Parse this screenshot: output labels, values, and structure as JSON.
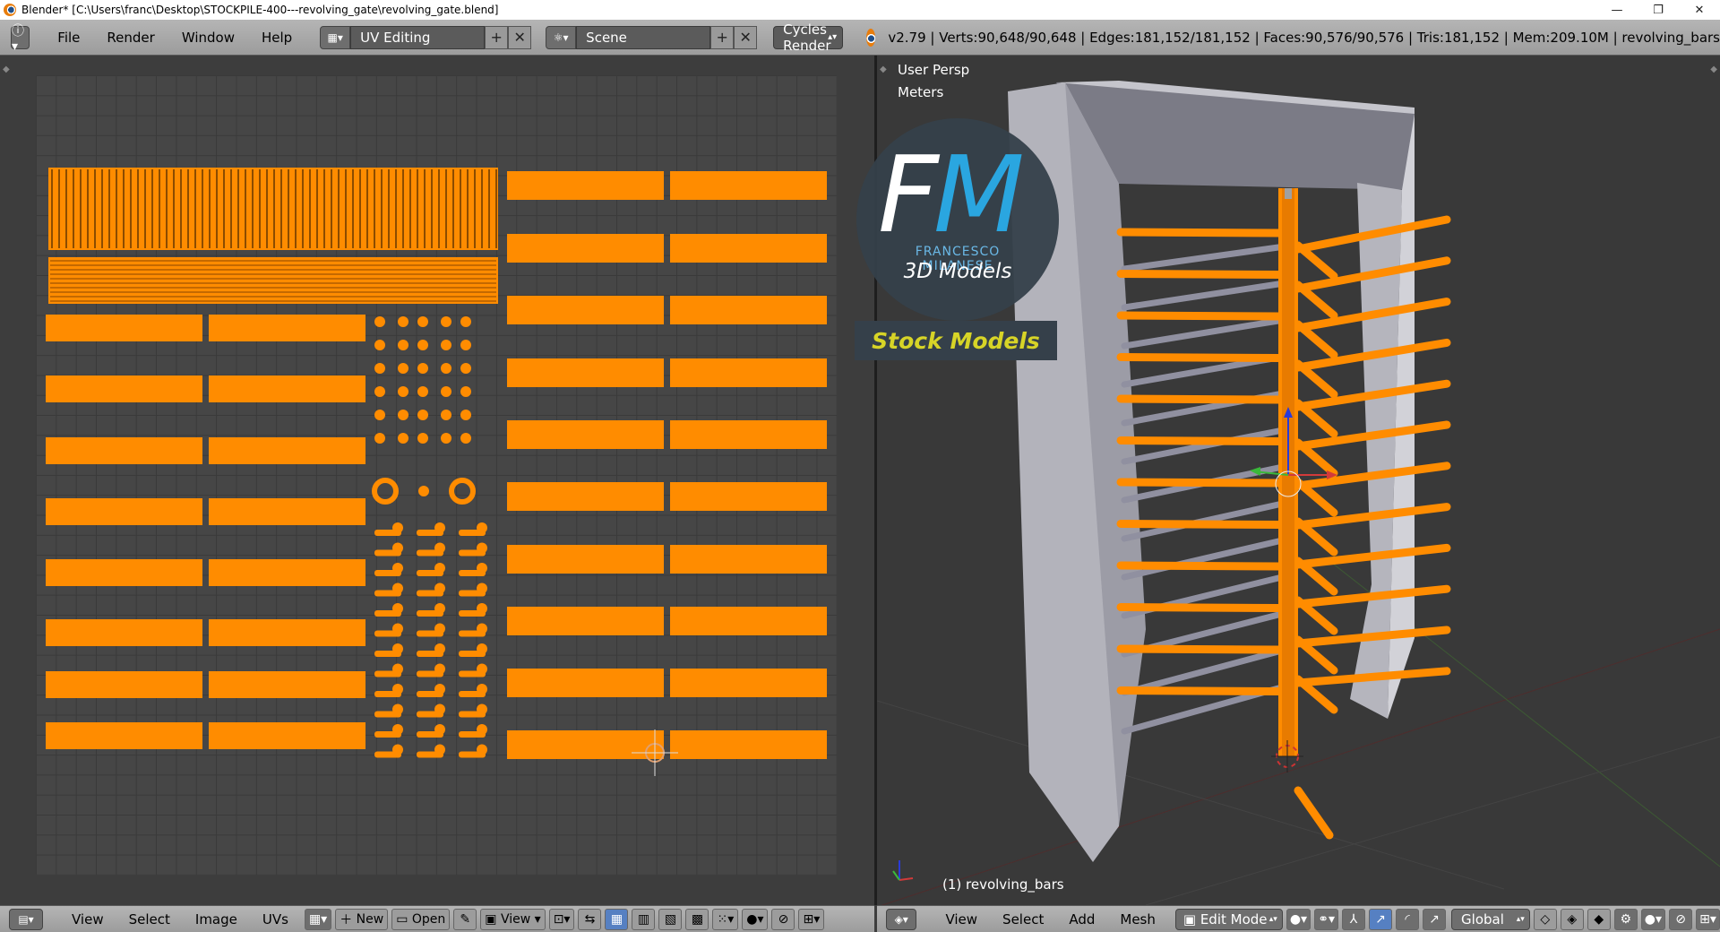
{
  "window": {
    "title": "Blender* [C:\\Users\\franc\\Desktop\\STOCKPILE-400---revolving_gate\\revolving_gate.blend]",
    "controls": {
      "minimize": "—",
      "maximize": "❐",
      "close": "✕"
    }
  },
  "info_header": {
    "menus": [
      "File",
      "Render",
      "Window",
      "Help"
    ],
    "screen_layout": "UV Editing",
    "scene": "Scene",
    "render_engine": "Cycles Render",
    "stats": "v2.79 | Verts:90,648/90,648 | Edges:181,152/181,152 | Faces:90,576/90,576 | Tris:181,152 | Mem:209.10M | revolving_bars"
  },
  "uv_editor": {
    "footer_menus": [
      "View",
      "Select",
      "Image",
      "UVs"
    ],
    "new_label": "New",
    "open_label": "Open",
    "view_label": "View"
  },
  "viewport": {
    "view_name": "User Persp",
    "units": "Meters",
    "object_label": "(1) revolving_bars",
    "footer_menus": [
      "View",
      "Select",
      "Add",
      "Mesh"
    ],
    "mode": "Edit Mode",
    "orientation": "Global"
  },
  "watermark": {
    "fm_f": "F",
    "fm_m": "M",
    "name": "FRANCESCO MILANESE",
    "subtitle": "3D Models",
    "badge": "Stock Models"
  },
  "colors": {
    "uv_orange": "#ff8c00",
    "frame_gray": "#a9a9b3",
    "bar_gray": "#9090a0",
    "bg_dark": "#393939",
    "watermark_blue": "#2aa6e0",
    "badge_yellow": "#d7d427"
  }
}
